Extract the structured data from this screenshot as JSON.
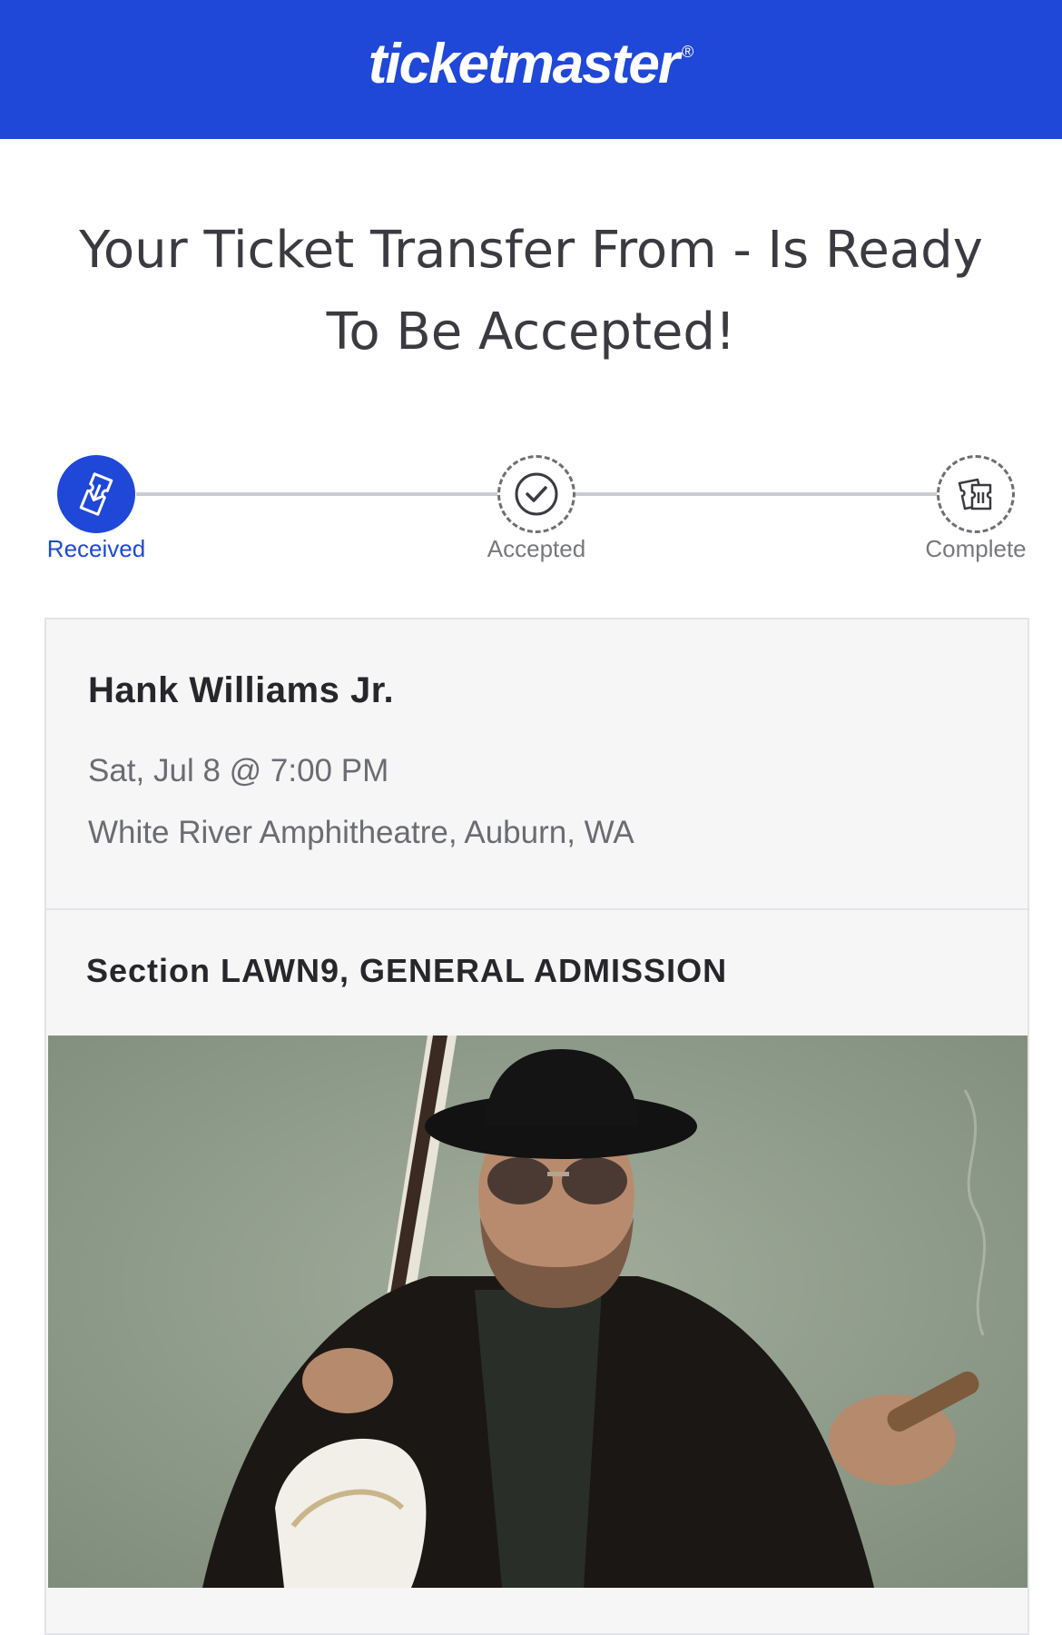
{
  "header": {
    "logo_text": "ticketmaster",
    "logo_mark": "®",
    "brand_color": "#1f47d8"
  },
  "title": {
    "line1": "Your Ticket Transfer From - Is Ready",
    "line2": "To Be Accepted!"
  },
  "progress": {
    "steps": [
      {
        "label": "Received",
        "state": "active",
        "icon": "ticket-download-icon"
      },
      {
        "label": "Accepted",
        "state": "pending",
        "icon": "checkmark-icon"
      },
      {
        "label": "Complete",
        "state": "pending",
        "icon": "tickets-icon"
      }
    ]
  },
  "event": {
    "artist": "Hank Williams Jr.",
    "datetime": "Sat, Jul 8 @ 7:00 PM",
    "venue": "White River Amphitheatre, Auburn, WA"
  },
  "seat": {
    "section": "Section LAWN9, GENERAL ADMISSION"
  },
  "image": {
    "description": "artist-photo"
  }
}
